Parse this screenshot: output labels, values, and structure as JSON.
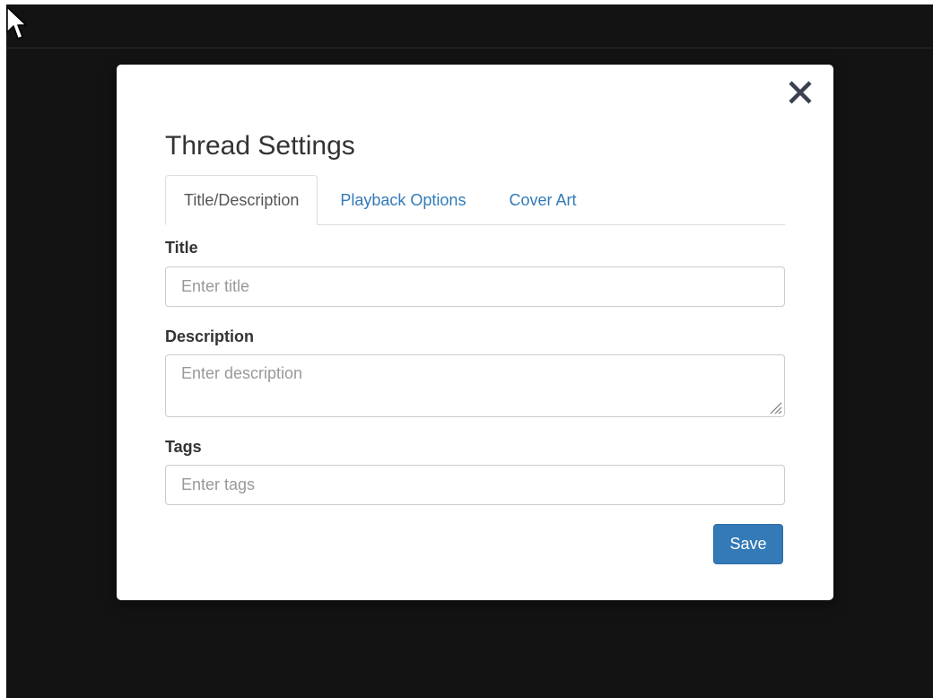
{
  "colors": {
    "backdrop": "#131313",
    "primary": "#337ab7",
    "tab_link": "#337ab7",
    "text": "#333333",
    "placeholder": "#999999",
    "close_icon": "#3b4151"
  },
  "modal": {
    "title": "Thread Settings",
    "close_icon": "close-icon",
    "tabs": [
      {
        "label": "Title/Description",
        "active": true
      },
      {
        "label": "Playback Options",
        "active": false
      },
      {
        "label": "Cover Art",
        "active": false
      }
    ],
    "fields": {
      "title": {
        "label": "Title",
        "placeholder": "Enter title",
        "value": ""
      },
      "description": {
        "label": "Description",
        "placeholder": "Enter description",
        "value": ""
      },
      "tags": {
        "label": "Tags",
        "placeholder": "Enter tags",
        "value": ""
      }
    },
    "save_label": "Save"
  }
}
